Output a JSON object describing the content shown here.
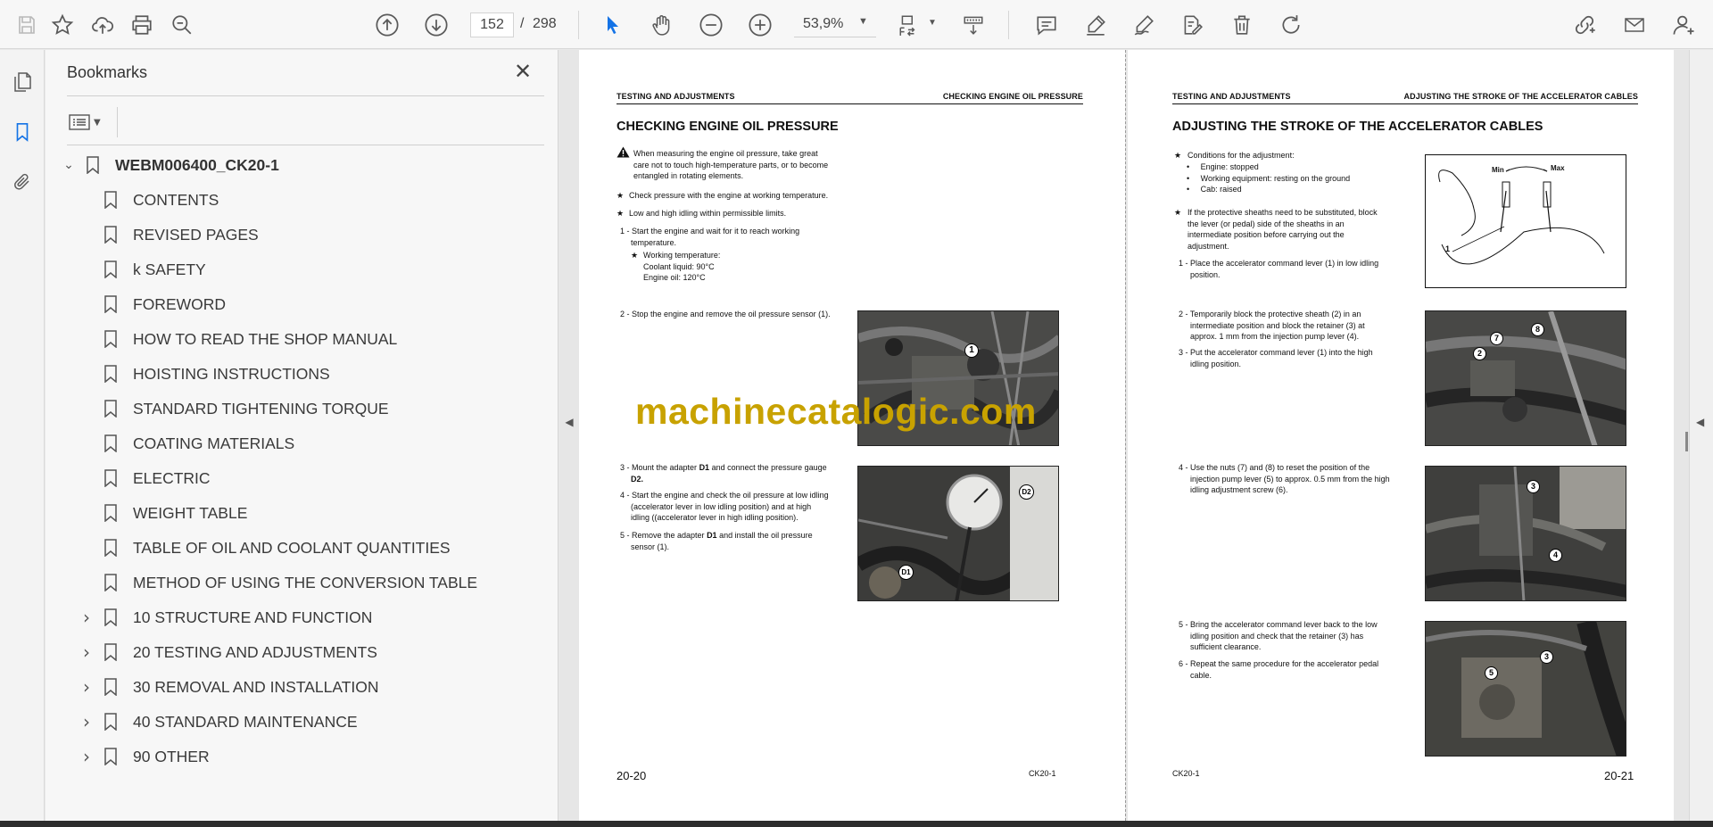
{
  "toolbar": {
    "page_current": "152",
    "page_separator": "/",
    "page_total": "298",
    "zoom": "53,9%"
  },
  "bookmarks": {
    "title": "Bookmarks",
    "root": "WEBM006400_CK20-1",
    "items": [
      {
        "label": "CONTENTS",
        "expandable": false
      },
      {
        "label": "REVISED PAGES",
        "expandable": false
      },
      {
        "label": "k SAFETY",
        "expandable": false
      },
      {
        "label": "FOREWORD",
        "expandable": false
      },
      {
        "label": "HOW TO READ THE SHOP MANUAL",
        "expandable": false
      },
      {
        "label": "HOISTING INSTRUCTIONS",
        "expandable": false
      },
      {
        "label": "STANDARD TIGHTENING TORQUE",
        "expandable": false
      },
      {
        "label": "COATING MATERIALS",
        "expandable": false
      },
      {
        "label": "ELECTRIC",
        "expandable": false
      },
      {
        "label": "WEIGHT TABLE",
        "expandable": false
      },
      {
        "label": "TABLE OF OIL AND COOLANT QUANTITIES",
        "expandable": false
      },
      {
        "label": "METHOD OF USING THE CONVERSION TABLE",
        "expandable": false
      },
      {
        "label": "10 STRUCTURE AND FUNCTION",
        "expandable": true
      },
      {
        "label": "20 TESTING AND ADJUSTMENTS",
        "expandable": true
      },
      {
        "label": "30 REMOVAL AND INSTALLATION",
        "expandable": true
      },
      {
        "label": "40 STANDARD MAINTENANCE",
        "expandable": true
      },
      {
        "label": "90 OTHER",
        "expandable": true
      }
    ]
  },
  "left_page": {
    "header_left": "TESTING AND ADJUSTMENTS",
    "header_right": "CHECKING ENGINE OIL PRESSURE",
    "title": "CHECKING ENGINE OIL PRESSURE",
    "warning_line1": "When measuring the engine oil pressure, take great",
    "warning_line2": "care not to touch high-temperature parts, or to become",
    "warning_line3": "entangled in rotating elements.",
    "note1": "Check pressure with the engine at working temperature.",
    "note2": "Low and high idling within permissible limits.",
    "step1_line1": "1 - Start the engine and wait for it to reach working",
    "step1_line2": "temperature.",
    "step1_sub1": "Working temperature:",
    "step1_sub2": "Coolant liquid: 90°C",
    "step1_sub3": "Engine oil: 120°C",
    "step2": "2 - Stop the engine and remove the oil pressure sensor (1).",
    "step3_line1a": "3 - Mount the adapter ",
    "step3_line1b": "D1",
    "step3_line1c": " and connect the pressure gauge",
    "step3_line2": "D2.",
    "step4_line1": "4 - Start the engine and check the oil pressure at low idling",
    "step4_line2": "(accelerator lever in low idling position) and at high",
    "step4_line3": "idling ((accelerator lever in high idling position).",
    "step5_line1a": "5 - Remove the adapter ",
    "step5_line1b": "D1",
    "step5_line1c": " and install the oil pressure",
    "step5_line2": "sensor (1).",
    "photo1_callout": "1",
    "photo2_callout1": "D2",
    "photo2_callout2": "D1",
    "page_number": "20-20",
    "page_code": "CK20-1"
  },
  "right_page": {
    "header_left": "TESTING AND ADJUSTMENTS",
    "header_right": "ADJUSTING THE STROKE OF THE ACCELERATOR CABLES",
    "title": "ADJUSTING THE STROKE OF THE ACCELERATOR CABLES",
    "cond_title": "Conditions for the adjustment:",
    "cond1": "Engine: stopped",
    "cond2": "Working equipment: resting on the ground",
    "cond3": "Cab: raised",
    "sheath_line1": "If the protective sheaths need to be substituted,  block",
    "sheath_line2": "the lever (or pedal) side of the sheaths in an",
    "sheath_line3": "intermediate position before carrying out the",
    "sheath_line4": "adjustment.",
    "step1_line1": "1 - Place the accelerator command lever (1) in low idling",
    "step1_line2": "position.",
    "step2_line1": "2 - Temporarily block the protective sheath (2) in an",
    "step2_line2": "intermediate position and block the retainer (3) at",
    "step2_line3": "approx. 1 mm from the injection pump lever (4).",
    "step3_line1": "3 - Put the accelerator command lever (1) into the high",
    "step3_line2": "idling position.",
    "step4_line1": "4 - Use the nuts (7) and (8) to reset the position of the",
    "step4_line2": "injection pump lever (5) to approx. 0.5 mm from the high",
    "step4_line3": "idling adjustment screw (6).",
    "step5_line1": "5 - Bring the accelerator command lever back to the low",
    "step5_line2": "idling position and check that the retainer (3) has",
    "step5_line3": "sufficient clearance.",
    "step6_line1": "6 - Repeat the same procedure for the accelerator pedal",
    "step6_line2": "cable.",
    "sketch_min": "Min",
    "sketch_max": "Max",
    "sketch_callout": "1",
    "photo1_c7": "7",
    "photo1_c8": "8",
    "photo1_c2": "2",
    "photo2_c3": "3",
    "photo2_c4": "4",
    "photo3_c5": "5",
    "photo3_c3": "3",
    "page_number": "20-21",
    "page_code": "CK20-1"
  },
  "watermark": "machinecatalogic.com",
  "colors": {
    "accent": "#1473e6",
    "watermark": "#c8a200"
  }
}
